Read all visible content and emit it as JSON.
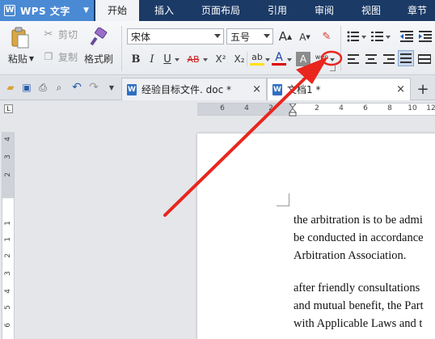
{
  "app": {
    "logo": "W",
    "name": "WPS 文字",
    "caret": "▼"
  },
  "menu_tabs": [
    "开始",
    "插入",
    "页面布局",
    "引用",
    "审阅",
    "视图",
    "章节"
  ],
  "ribbon": {
    "paste": "粘贴",
    "cut": "剪切",
    "copy": "复制",
    "format_painter": "格式刷",
    "font_name": "宋体",
    "font_size": "五号",
    "grow_font": "A",
    "shrink_font": "A",
    "bold": "B",
    "italic": "I",
    "underline": "U",
    "strike": "AB",
    "superscript": "X²",
    "subscript": "X₂",
    "highlight": "ab",
    "font_color": "A",
    "char_shading": "A",
    "phonetic": "wén",
    "accent_color": "#1b3a66"
  },
  "doc_tabs": [
    {
      "icon": "W",
      "title": "经验目标文件. doc *",
      "close": "×"
    },
    {
      "icon": "W",
      "title": "文档1 *",
      "close": "×"
    }
  ],
  "new_tab": "+",
  "ruler": {
    "h_numbers": [
      "6",
      "4",
      "2",
      "",
      "2",
      "4",
      "6",
      "8",
      "10",
      "12"
    ],
    "v_numbers": [
      "4",
      "3",
      "2",
      "1",
      "",
      "1",
      "2",
      "3",
      "4",
      "5",
      "6",
      "7"
    ]
  },
  "document": {
    "paragraphs": [
      [
        "the arbitration is to be admi",
        "be conducted in accordance",
        "Arbitration Association."
      ],
      [
        "after friendly consultations",
        "and mutual benefit, the Part",
        "with Applicable Laws and t"
      ]
    ]
  },
  "annotation": {
    "color": "#e8261e"
  }
}
